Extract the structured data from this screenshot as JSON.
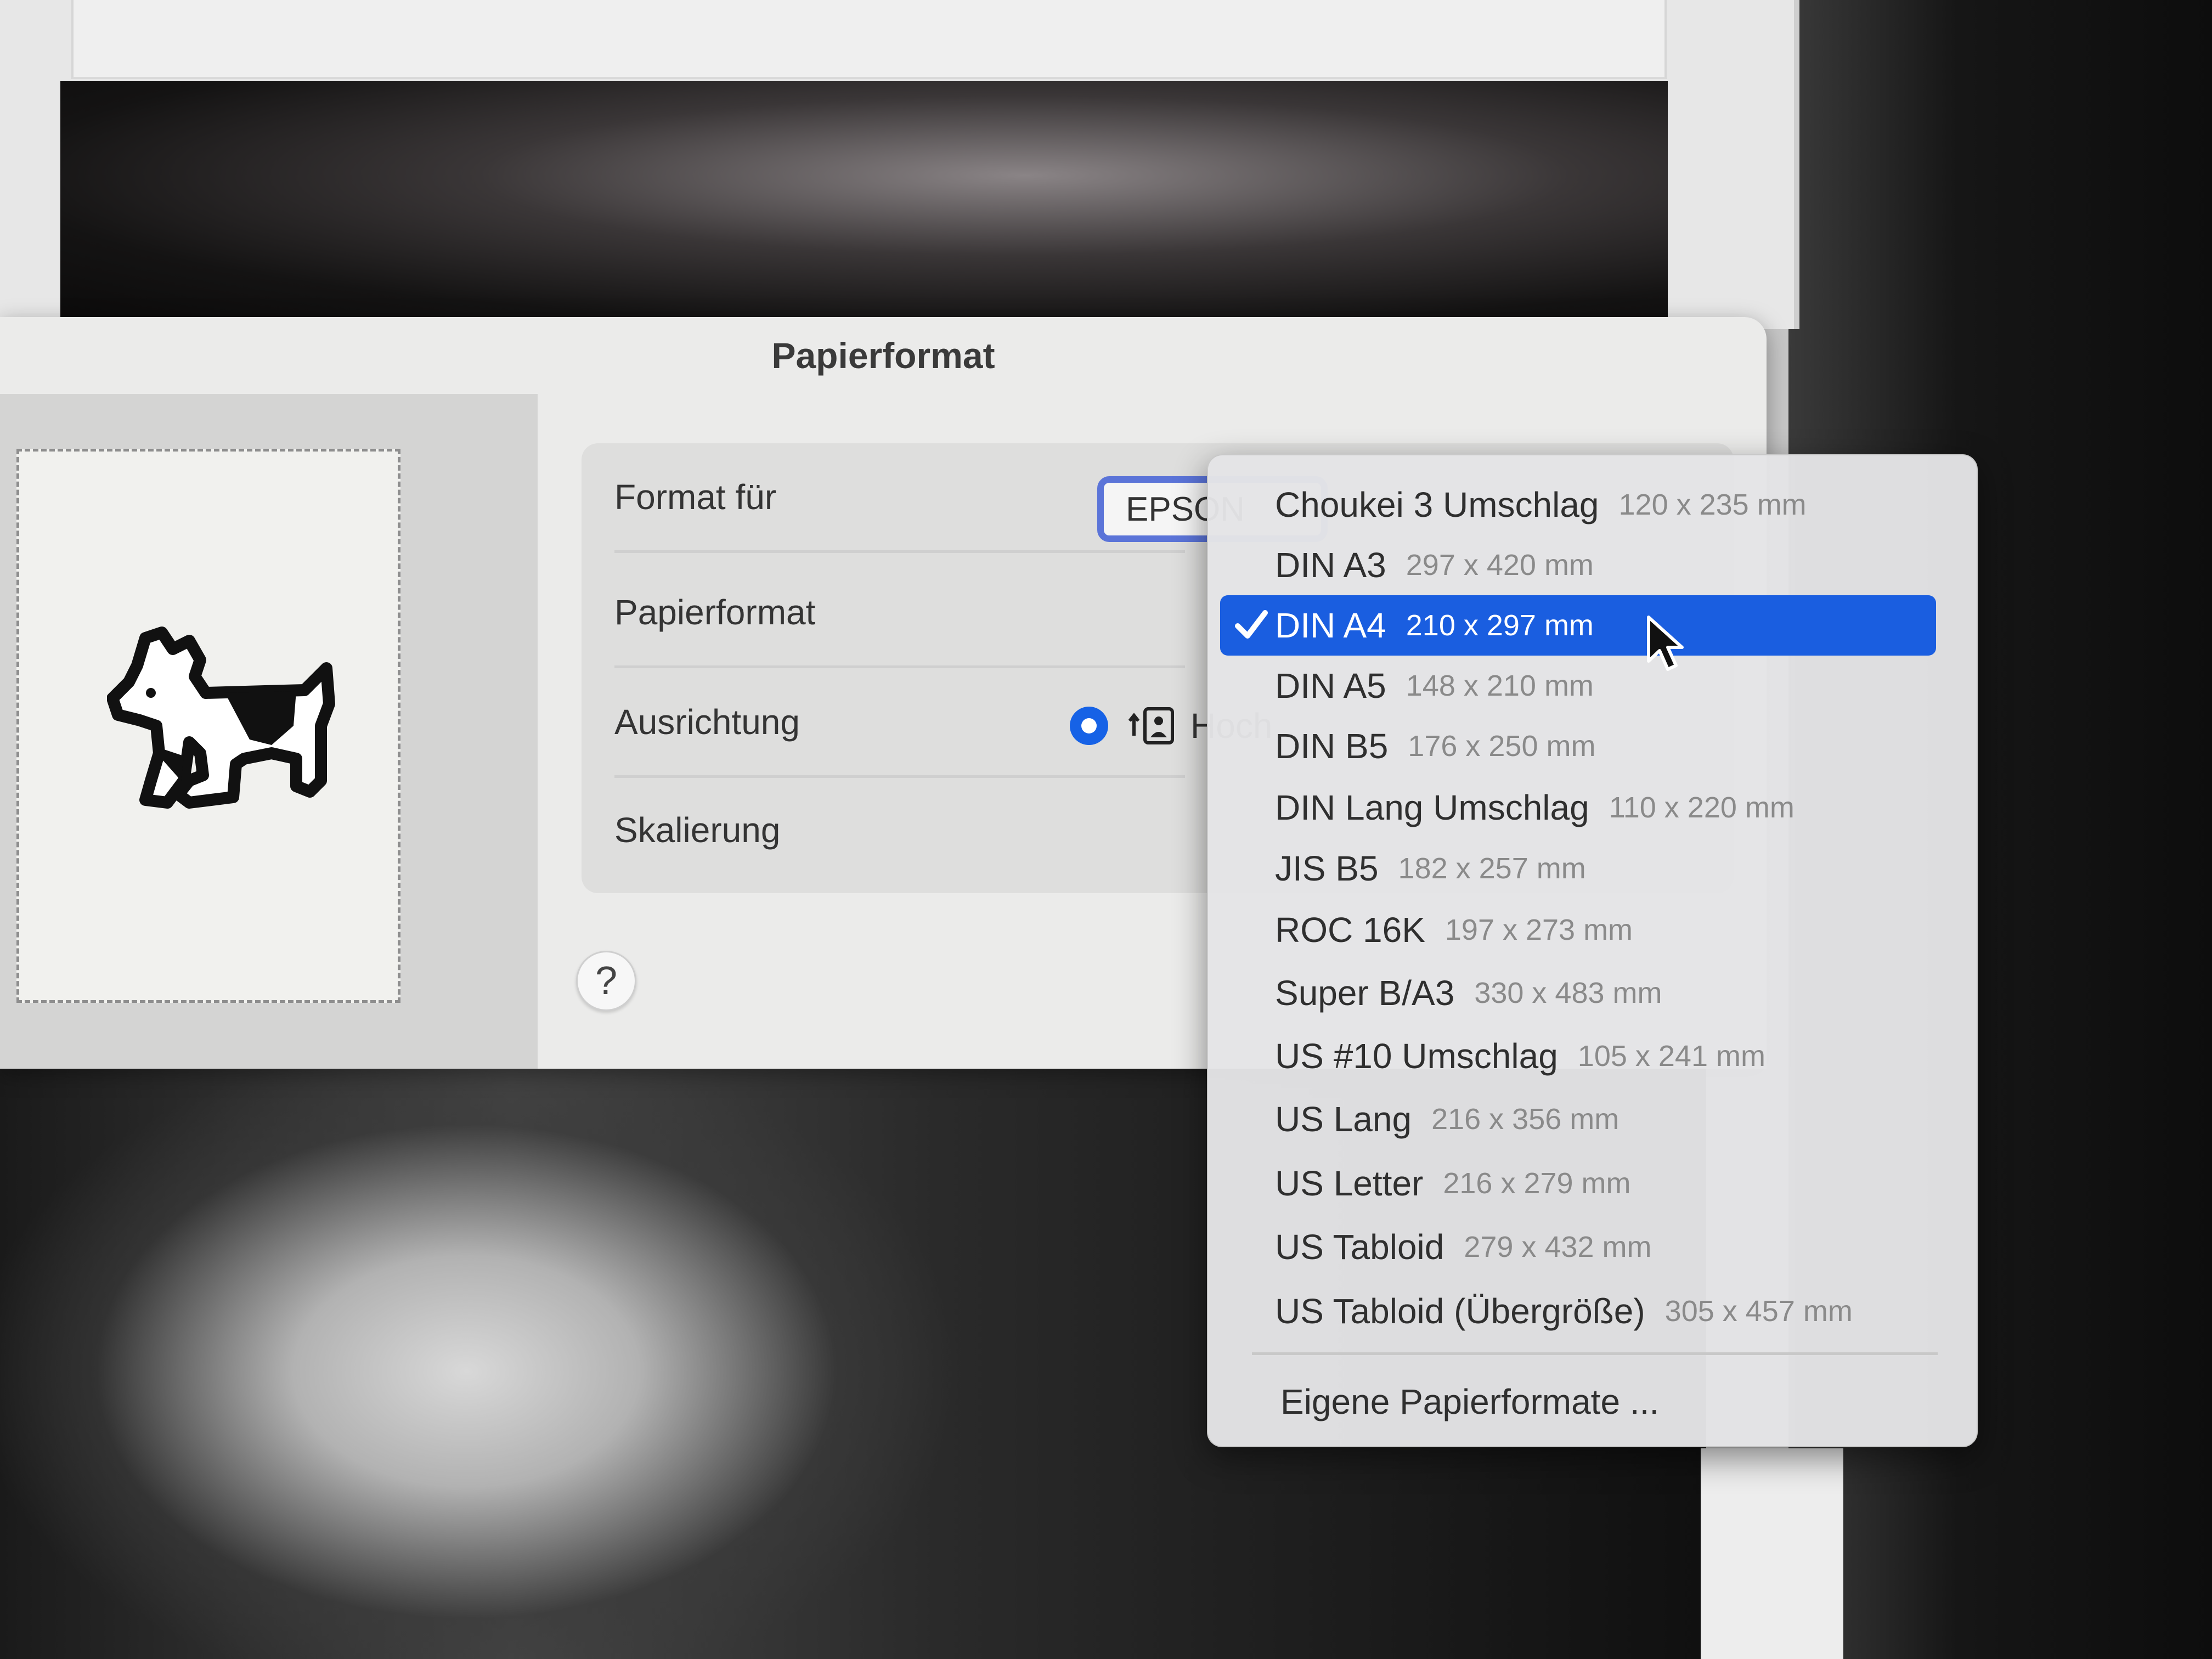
{
  "dialog": {
    "title": "Papierformat",
    "rows": {
      "format_fuer": {
        "label": "Format für",
        "value": "EPSON"
      },
      "papierformat": {
        "label": "Papierformat"
      },
      "ausrichtung": {
        "label": "Ausrichtung",
        "option": "Hoch"
      },
      "skalierung": {
        "label": "Skalierung"
      }
    },
    "help_label": "?"
  },
  "menu": {
    "selected_index": 2,
    "items": [
      {
        "name": "Choukei 3 Umschlag",
        "dims": "120 x 235 mm"
      },
      {
        "name": "DIN A3",
        "dims": "297 x 420 mm"
      },
      {
        "name": "DIN A4",
        "dims": "210 x 297 mm"
      },
      {
        "name": "DIN A5",
        "dims": "148 x 210 mm"
      },
      {
        "name": "DIN B5",
        "dims": "176 x 250 mm"
      },
      {
        "name": "DIN Lang Umschlag",
        "dims": "110 x 220 mm"
      },
      {
        "name": "JIS B5",
        "dims": "182 x 257 mm"
      },
      {
        "name": "ROC 16K",
        "dims": "197 x 273 mm"
      },
      {
        "name": "Super B/A3",
        "dims": "330 x 483 mm"
      },
      {
        "name": "US #10 Umschlag",
        "dims": "105 x 241 mm"
      },
      {
        "name": "US Lang",
        "dims": "216 x 356 mm"
      },
      {
        "name": "US Letter",
        "dims": "216 x 279 mm"
      },
      {
        "name": "US Tabloid",
        "dims": "279 x 432 mm"
      },
      {
        "name": "US Tabloid (Übergröße)",
        "dims": "305 x 457 mm"
      }
    ],
    "footer": "Eigene Papierformate ..."
  },
  "colors": {
    "accent": "#1a5ee0",
    "radio": "#1662e6",
    "field_focus": "#5b74d8"
  }
}
